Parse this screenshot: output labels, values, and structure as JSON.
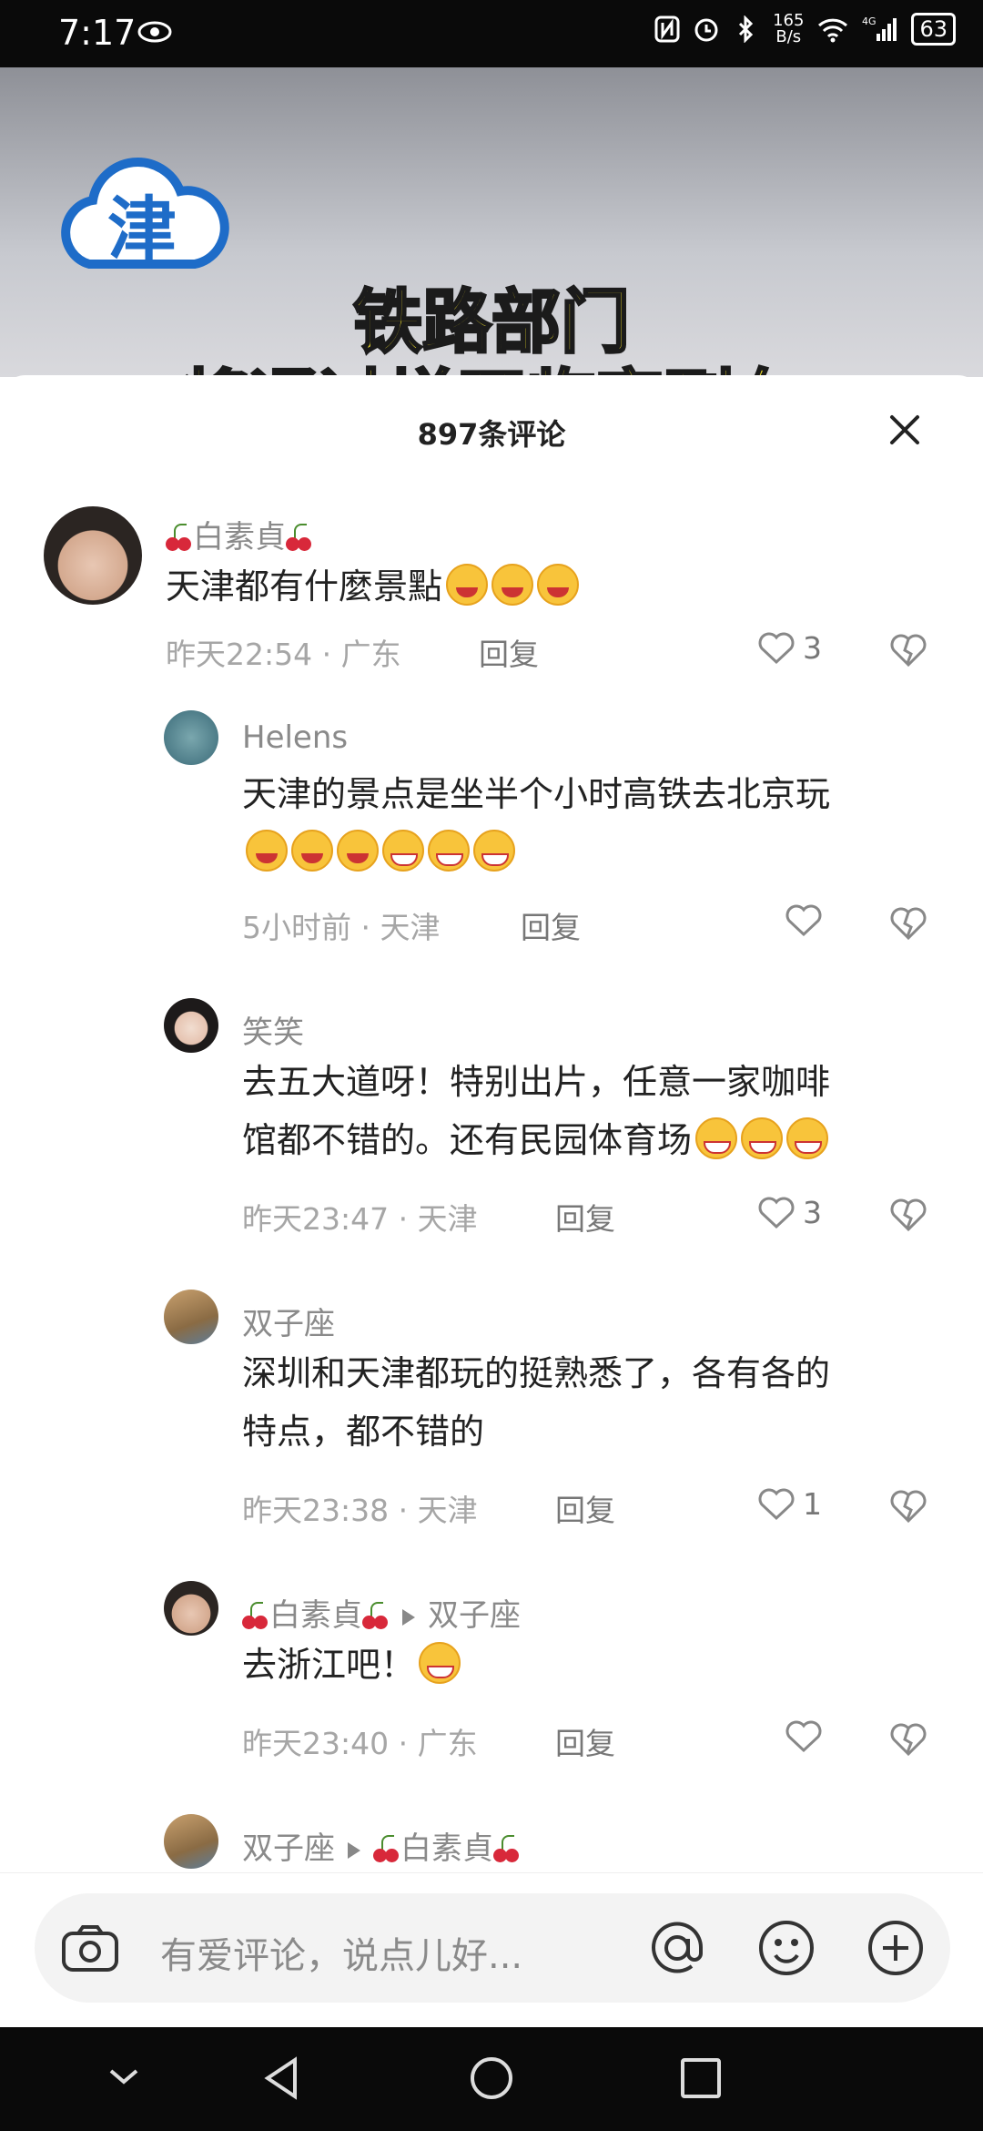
{
  "status_bar": {
    "time": "7:17",
    "net_speed_top": "165",
    "net_speed_bottom": "B/s",
    "signal": "4G",
    "battery": "63"
  },
  "video": {
    "logo_char": "津",
    "headline_1": "铁路部门",
    "headline_2": "将通过增开临客列车"
  },
  "comments_panel": {
    "title": "897条评论"
  },
  "comments": [
    {
      "user": "白素貞",
      "text": "天津都有什麼景點",
      "time": "昨天22:54",
      "place": "广东",
      "reply": "回复",
      "likes": "3"
    },
    {
      "user": "Helens",
      "text": "天津的景点是坐半个小时高铁去北京玩",
      "time": "5小时前",
      "place": "天津",
      "reply": "回复",
      "likes": ""
    },
    {
      "user": "笑笑",
      "text_1": "去五大道呀！特别出片，任意一家咖啡",
      "text_2": "馆都不错的。还有民园体育场",
      "time": "昨天23:47",
      "place": "天津",
      "reply": "回复",
      "likes": "3"
    },
    {
      "user": "双子座",
      "text_1": "深圳和天津都玩的挺熟悉了，各有各的",
      "text_2": "特点，都不错的",
      "time": "昨天23:38",
      "place": "天津",
      "reply": "回复",
      "likes": "1"
    },
    {
      "user": "白素貞",
      "reply_to": "双子座",
      "text": "去浙江吧！",
      "time": "昨天23:40",
      "place": "广东",
      "reply": "回复",
      "likes": ""
    },
    {
      "user": "双子座",
      "reply_to": "白素貞"
    }
  ],
  "input": {
    "placeholder": "有爱评论，说点儿好..."
  },
  "icons": {
    "camera": "camera-icon",
    "at": "at-icon",
    "emoji": "emoji-icon",
    "add": "plus-icon"
  }
}
